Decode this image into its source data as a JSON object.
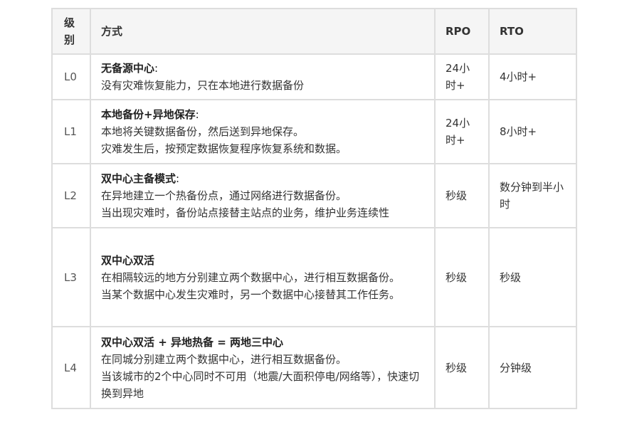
{
  "table": {
    "headers": {
      "level": "级别",
      "method": "方式",
      "rpo": "RPO",
      "rto": "RTO"
    },
    "rows": [
      {
        "level": "L0",
        "title": "无备源中心",
        "title_suffix": ":",
        "lines": [
          "没有灾难恢复能力，只在本地进行数据备份"
        ],
        "rpo": "24小时+",
        "rto": "4小时+"
      },
      {
        "level": "L1",
        "title": "本地备份+异地保存",
        "title_suffix": ":",
        "lines": [
          "本地将关键数据备份，然后送到异地保存。",
          "灾难发生后，按预定数据恢复程序恢复系统和数据。"
        ],
        "rpo": "24小时+",
        "rto": "8小时+"
      },
      {
        "level": "L2",
        "title": "双中心主备模式",
        "title_suffix": ":",
        "lines": [
          "在异地建立一个热备份点，通过网络进行数据备份。",
          "当出现灾难时，备份站点接替主站点的业务，维护业务连续性"
        ],
        "rpo": "秒级",
        "rto": "数分钟到半小时"
      },
      {
        "level": "L3",
        "title": "双中心双活",
        "title_suffix": "",
        "lines": [
          "在相隔较远的地方分别建立两个数据中心，进行相互数据备份。",
          "当某个数据中心发生灾难时，另一个数据中心接替其工作任务。"
        ],
        "rpo": "秒级",
        "rto": "秒级"
      },
      {
        "level": "L4",
        "title": "双中心双活 + 异地热备 = 两地三中心",
        "title_suffix": "",
        "lines": [
          "在同城分别建立两个数据中心，进行相互数据备份。",
          "当该城市的2个中心同时不可用（地震/大面积停电/网络等），快速切换到异地"
        ],
        "rpo": "秒级",
        "rto": "分钟级"
      }
    ]
  }
}
